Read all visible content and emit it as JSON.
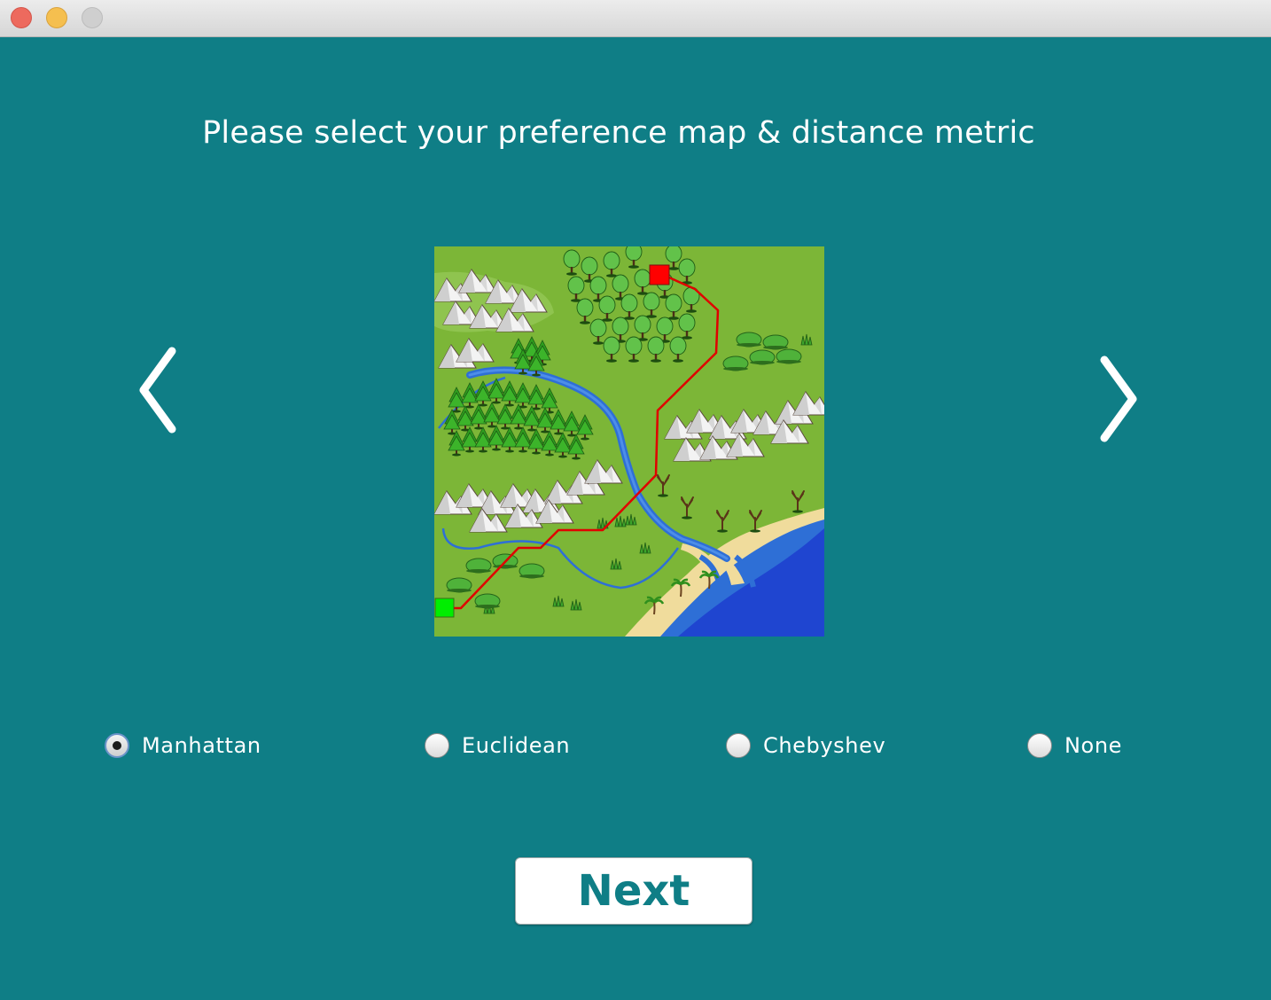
{
  "window": {
    "controls": [
      "close",
      "minimize",
      "zoom"
    ]
  },
  "heading": "Please select your preference map & distance metric",
  "navigation": {
    "prev_icon": "chevron-left-icon",
    "next_icon": "chevron-right-icon"
  },
  "map": {
    "start_color": "#00ee00",
    "goal_color": "#ff0000",
    "path_color": "#e00000"
  },
  "metrics": {
    "selected": "Manhattan",
    "options": [
      {
        "label": "Manhattan",
        "selected": true
      },
      {
        "label": "Euclidean",
        "selected": false
      },
      {
        "label": "Chebyshev",
        "selected": false
      },
      {
        "label": "None",
        "selected": false
      }
    ]
  },
  "next_button": "Next",
  "colors": {
    "background": "#0f7e86",
    "text": "#ffffff",
    "button_text": "#0f7e86"
  }
}
